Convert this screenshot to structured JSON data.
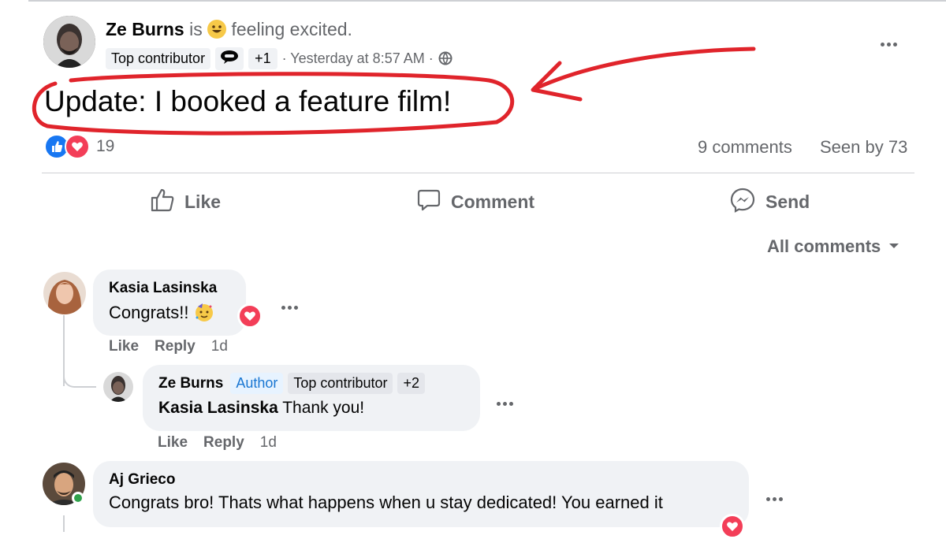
{
  "post": {
    "author": "Ze Burns",
    "is_word": "is",
    "feeling_text": "feeling excited.",
    "badges": [
      "Top contributor",
      "+1"
    ],
    "timestamp": "· Yesterday at 8:57 AM ·",
    "body": "Update: I booked a feature film!",
    "reaction_count": "19",
    "comments_count": "9 comments",
    "seen_by": "Seen by 73"
  },
  "actions": {
    "like": "Like",
    "comment": "Comment",
    "send": "Send"
  },
  "filter": {
    "label": "All comments"
  },
  "comments": [
    {
      "author": "Kasia Lasinska",
      "text": "Congrats!!",
      "like": "Like",
      "reply": "Reply",
      "time": "1d",
      "reply_item": {
        "author": "Ze Burns",
        "badges": [
          "Author",
          "Top contributor",
          "+2"
        ],
        "mention": "Kasia Lasinska",
        "text": "Thank you!",
        "like": "Like",
        "reply": "Reply",
        "time": "1d"
      }
    },
    {
      "author": "Aj Grieco",
      "text": "Congrats bro! Thats what happens when u stay dedicated! You earned it"
    }
  ],
  "colors": {
    "annotation_red": "#e0242b",
    "like_blue": "#1877f2",
    "love_red": "#f33e58",
    "author_badge_text": "#1876d2",
    "online_green": "#31a24c"
  }
}
